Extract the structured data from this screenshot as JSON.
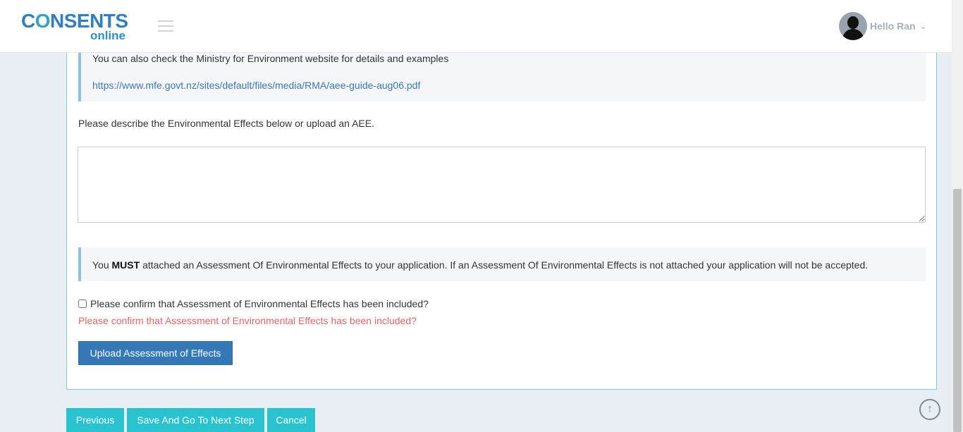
{
  "header": {
    "logo_main_prefix": "C",
    "logo_main_o": "O",
    "logo_main_suffix": "NSENTS",
    "logo_sub": "online",
    "user_greeting": "Hello Ran"
  },
  "aee_section": {
    "info_text": "You can also check the Ministry for Environment website for details and examples",
    "info_link": "https://www.mfe.govt.nz/sites/default/files/media/RMA/aee-guide-aug06.pdf",
    "describe_label": "Please describe the Environmental Effects below or upload an AEE.",
    "textarea_value": "",
    "warning_prefix": "You ",
    "warning_bold": "MUST",
    "warning_suffix": " attached an Assessment Of Environmental Effects to your application. If an Assessment Of Environmental Effects is not attached your application will not be accepted.",
    "confirm_label": "Please confirm that Assessment of Environmental Effects has been included?",
    "confirm_checked": false,
    "error_message": "Please confirm that Assessment of Environmental Effects has been included?",
    "upload_button": "Upload Assessment of Effects"
  },
  "footer_buttons": {
    "previous": "Previous",
    "save_next": "Save And Go To Next Step",
    "cancel": "Cancel"
  },
  "icons": {
    "menu": "hamburger-menu-icon",
    "user_dropdown": "chevron-down-icon",
    "scroll_top": "arrow-up-circle-icon"
  },
  "colors": {
    "accent_teal": "#29c3cf",
    "primary_blue": "#3478b7",
    "error_red": "#e06767",
    "link_blue": "#3a78b5"
  }
}
